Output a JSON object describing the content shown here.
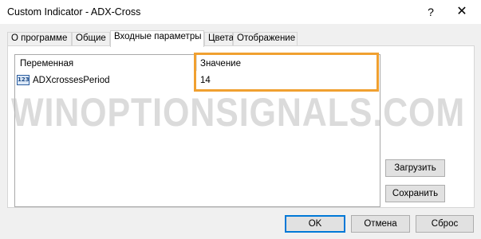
{
  "window": {
    "title": "Custom Indicator - ADX-Cross",
    "help_glyph": "?",
    "close_glyph": "✕"
  },
  "tabs": [
    {
      "label": "О программе"
    },
    {
      "label": "Общие"
    },
    {
      "label": "Входные параметры",
      "active": true
    },
    {
      "label": "Цвета"
    },
    {
      "label": "Отображение"
    }
  ],
  "grid": {
    "columns": {
      "variable": "Переменная",
      "value": "Значение"
    },
    "rows": [
      {
        "type_icon": "integer-type-icon",
        "type_badge": "123",
        "name": "ADXcrossesPeriod",
        "value": "14"
      }
    ]
  },
  "side_buttons": {
    "load": "Загрузить",
    "save": "Сохранить"
  },
  "footer_buttons": {
    "ok": "OK",
    "cancel": "Отмена",
    "reset": "Сброс"
  },
  "watermark": "WINOPTIONSIGNALS.COM",
  "colors": {
    "highlight": "#f0a030",
    "ok_border": "#0078d7",
    "badge_border": "#2c5ea0"
  }
}
